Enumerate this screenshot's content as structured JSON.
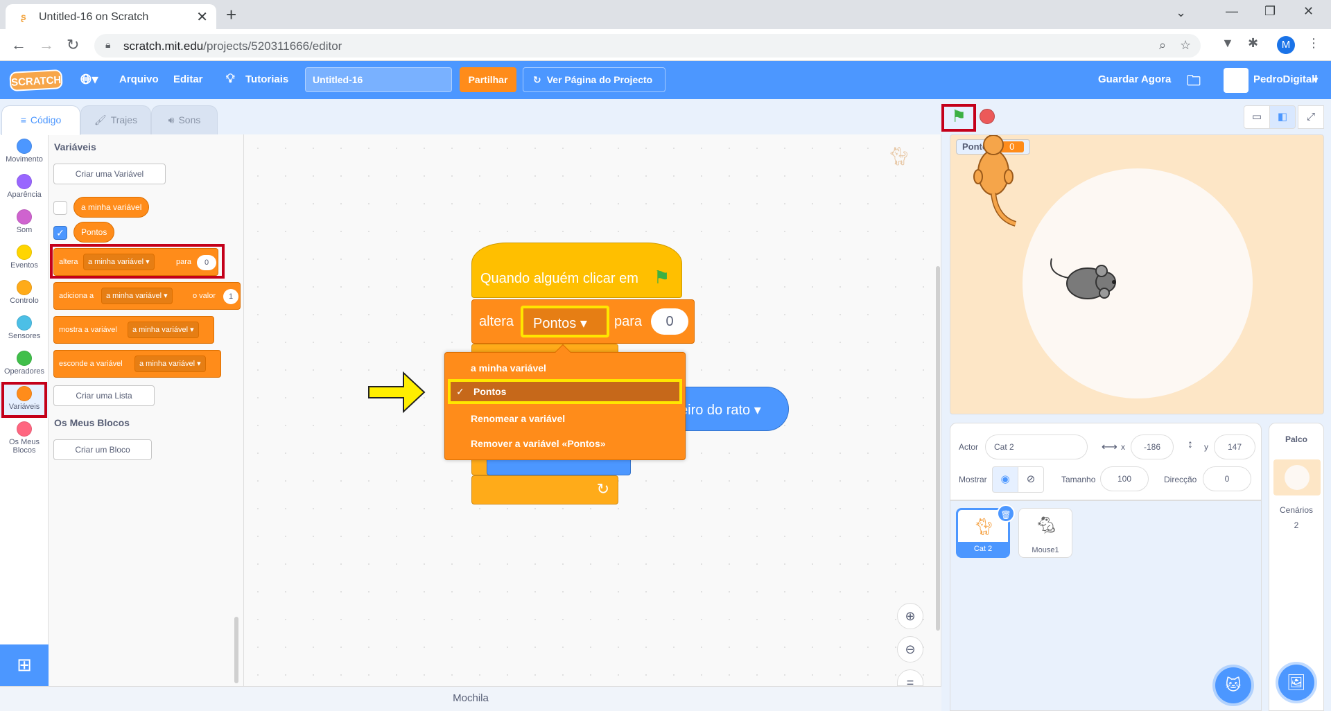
{
  "browser": {
    "tab_title": "Untitled-16 on Scratch",
    "url_host": "scratch.mit.edu",
    "url_path": "/projects/520311666/editor",
    "profile_initial": "M"
  },
  "menubar": {
    "logo": "SCRATCH",
    "file": "Arquivo",
    "edit": "Editar",
    "tutorials": "Tutoriais",
    "project_title": "Untitled-16",
    "share": "Partilhar",
    "see_project_page": "Ver Página do Projecto",
    "save_now": "Guardar Agora",
    "username": "PedroDigitall"
  },
  "editor_tabs": [
    "Código",
    "Trajes",
    "Sons"
  ],
  "categories": [
    {
      "label": "Movimento",
      "color": "#4c97ff"
    },
    {
      "label": "Aparência",
      "color": "#9966ff"
    },
    {
      "label": "Som",
      "color": "#cf63cf"
    },
    {
      "label": "Eventos",
      "color": "#ffd500"
    },
    {
      "label": "Controlo",
      "color": "#ffab19"
    },
    {
      "label": "Sensores",
      "color": "#4cbfe6"
    },
    {
      "label": "Operadores",
      "color": "#40bf4a"
    },
    {
      "label": "Variáveis",
      "color": "#ff8c1a"
    },
    {
      "label": "Os Meus Blocos",
      "color": "#ff6680"
    }
  ],
  "palette": {
    "heading": "Variáveis",
    "make_variable": "Criar uma Variável",
    "variables": [
      {
        "name": "a minha variável",
        "checked": false
      },
      {
        "name": "Pontos",
        "checked": true
      }
    ],
    "blocks": {
      "set_label": "altera",
      "set_var": "a minha variável",
      "set_to": "para",
      "set_value": "0",
      "change_label": "adiciona a",
      "change_var": "a minha variável",
      "change_by": "o valor",
      "change_value": "1",
      "show_label": "mostra a variável",
      "show_var": "a minha variável",
      "hide_label": "esconde a variável",
      "hide_var": "a minha variável"
    },
    "make_list": "Criar uma Lista",
    "my_blocks_heading": "Os Meus Blocos",
    "make_block": "Criar um Bloco"
  },
  "script": {
    "hat_text": "Quando alguém clicar em",
    "set_label": "altera",
    "set_var": "Pontos",
    "set_to": "para",
    "set_value": "0",
    "blue_block_text": "eiro do rato"
  },
  "dropdown": {
    "items": [
      "a minha variável",
      "Pontos",
      "Renomear a variável",
      "Remover a variável «Pontos»"
    ],
    "selected": "Pontos",
    "check": "✓"
  },
  "backpack": "Mochila",
  "stage": {
    "monitor_label": "Pontos",
    "monitor_value": "0"
  },
  "sprite_info": {
    "sprite_label": "Actor",
    "sprite_name": "Cat 2",
    "x_label": "x",
    "x_value": "-186",
    "y_label": "y",
    "y_value": "147",
    "show_label": "Mostrar",
    "size_label": "Tamanho",
    "size_value": "100",
    "direction_label": "Direcção",
    "direction_value": "0"
  },
  "sprites": [
    {
      "name": "Cat 2",
      "selected": true
    },
    {
      "name": "Mouse1",
      "selected": false
    }
  ],
  "stage_panel": {
    "title": "Palco",
    "backdrops_label": "Cenários",
    "backdrops_count": "2"
  }
}
